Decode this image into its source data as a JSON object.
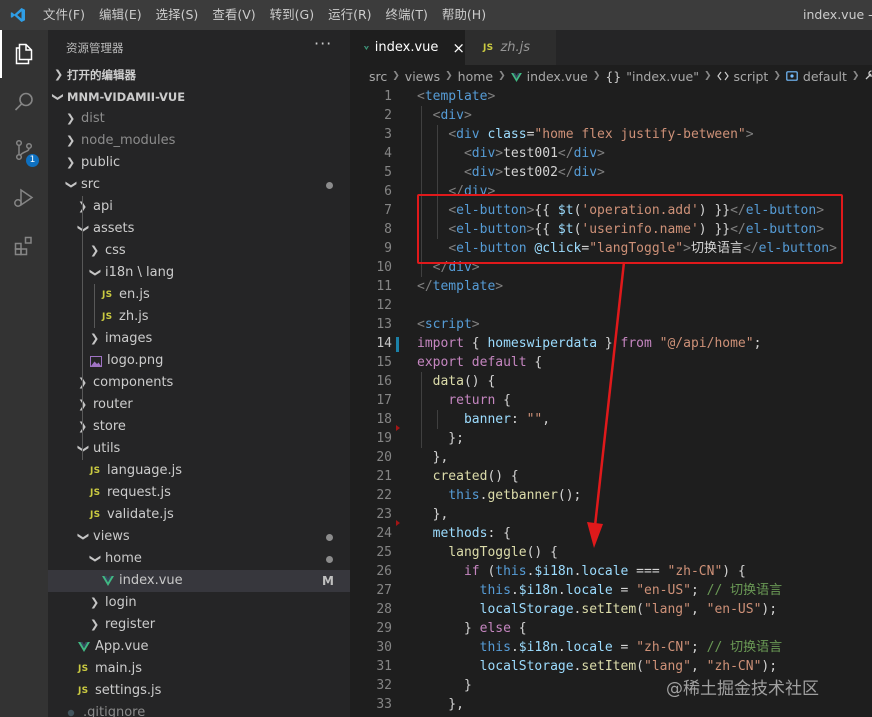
{
  "titlebar": {
    "menu": [
      "文件(F)",
      "编辑(E)",
      "选择(S)",
      "查看(V)",
      "转到(G)",
      "运行(R)",
      "终端(T)",
      "帮助(H)"
    ],
    "window_title": "index.vue - m"
  },
  "activity": {
    "items": [
      "explorer-icon",
      "search-icon",
      "source-control-icon",
      "run-debug-icon",
      "extensions-icon"
    ],
    "scm_badge": "1"
  },
  "sidebar": {
    "title": "资源管理器",
    "more": "···",
    "open_editors": "打开的编辑器",
    "project": "MNM-VIDAMII-VUE",
    "tree": [
      {
        "label": "dist",
        "kind": "folder",
        "state": "collapsed",
        "depth": 1
      },
      {
        "label": "node_modules",
        "kind": "folder",
        "state": "collapsed",
        "depth": 1
      },
      {
        "label": "public",
        "kind": "folder",
        "state": "collapsed",
        "depth": 1
      },
      {
        "label": "src",
        "kind": "folder",
        "state": "expanded",
        "depth": 1,
        "dot": true
      },
      {
        "label": "api",
        "kind": "folder",
        "state": "collapsed",
        "depth": 2
      },
      {
        "label": "assets",
        "kind": "folder",
        "state": "expanded",
        "depth": 2
      },
      {
        "label": "css",
        "kind": "folder",
        "state": "collapsed",
        "depth": 3
      },
      {
        "label": "i18n \\ lang",
        "kind": "folder",
        "state": "expanded",
        "depth": 3
      },
      {
        "label": "en.js",
        "kind": "js",
        "depth": 4
      },
      {
        "label": "zh.js",
        "kind": "js",
        "depth": 4
      },
      {
        "label": "images",
        "kind": "folder",
        "state": "collapsed",
        "depth": 3
      },
      {
        "label": "logo.png",
        "kind": "image",
        "depth": 3
      },
      {
        "label": "components",
        "kind": "folder",
        "state": "collapsed",
        "depth": 2
      },
      {
        "label": "router",
        "kind": "folder",
        "state": "collapsed",
        "depth": 2
      },
      {
        "label": "store",
        "kind": "folder",
        "state": "collapsed",
        "depth": 2
      },
      {
        "label": "utils",
        "kind": "folder",
        "state": "expanded",
        "depth": 2
      },
      {
        "label": "language.js",
        "kind": "js",
        "depth": 3
      },
      {
        "label": "request.js",
        "kind": "js",
        "depth": 3
      },
      {
        "label": "validate.js",
        "kind": "js",
        "depth": 3
      },
      {
        "label": "views",
        "kind": "folder",
        "state": "expanded",
        "depth": 2,
        "dot": true,
        "git": "modified"
      },
      {
        "label": "home",
        "kind": "folder",
        "state": "expanded",
        "depth": 3,
        "dot": true,
        "git": "modified"
      },
      {
        "label": "index.vue",
        "kind": "vue",
        "depth": 4,
        "flag": "M",
        "selected": true,
        "git": "modified"
      },
      {
        "label": "login",
        "kind": "folder",
        "state": "collapsed",
        "depth": 3
      },
      {
        "label": "register",
        "kind": "folder",
        "state": "collapsed",
        "depth": 3
      },
      {
        "label": "App.vue",
        "kind": "vue",
        "depth": 2
      },
      {
        "label": "main.js",
        "kind": "js",
        "depth": 2
      },
      {
        "label": "settings.js",
        "kind": "js",
        "depth": 2
      },
      {
        "label": ".gitignore",
        "kind": "file",
        "depth": 1
      }
    ]
  },
  "editor": {
    "tabs": [
      {
        "label": "index.vue",
        "kind": "vue",
        "active": true,
        "close": "×"
      },
      {
        "label": "zh.js",
        "kind": "js",
        "active": false
      }
    ],
    "breadcrumb": [
      "src",
      "views",
      "home",
      "index.vue",
      "\"index.vue\"",
      "script",
      "default",
      "me"
    ],
    "current_line": 14,
    "code": [
      {
        "n": 1,
        "tokens": [
          [
            "br",
            "<"
          ],
          [
            "tag",
            "template"
          ],
          [
            "br",
            ">"
          ]
        ]
      },
      {
        "n": 2,
        "tokens": [
          [
            "txt",
            "  "
          ],
          [
            "br",
            "<"
          ],
          [
            "tag",
            "div"
          ],
          [
            "br",
            ">"
          ]
        ]
      },
      {
        "n": 3,
        "tokens": [
          [
            "txt",
            "    "
          ],
          [
            "br",
            "<"
          ],
          [
            "tag",
            "div"
          ],
          [
            "txt",
            " "
          ],
          [
            "attr",
            "class"
          ],
          [
            "txt",
            "="
          ],
          [
            "str",
            "\"home flex justify-between\""
          ],
          [
            "br",
            ">"
          ]
        ]
      },
      {
        "n": 4,
        "tokens": [
          [
            "txt",
            "      "
          ],
          [
            "br",
            "<"
          ],
          [
            "tag",
            "div"
          ],
          [
            "br",
            ">"
          ],
          [
            "txt",
            "test001"
          ],
          [
            "br",
            "</"
          ],
          [
            "tag",
            "div"
          ],
          [
            "br",
            ">"
          ]
        ]
      },
      {
        "n": 5,
        "tokens": [
          [
            "txt",
            "      "
          ],
          [
            "br",
            "<"
          ],
          [
            "tag",
            "div"
          ],
          [
            "br",
            ">"
          ],
          [
            "txt",
            "test002"
          ],
          [
            "br",
            "</"
          ],
          [
            "tag",
            "div"
          ],
          [
            "br",
            ">"
          ]
        ]
      },
      {
        "n": 6,
        "tokens": [
          [
            "txt",
            "    "
          ],
          [
            "br",
            "</"
          ],
          [
            "tag",
            "div"
          ],
          [
            "br",
            ">"
          ]
        ]
      },
      {
        "n": 7,
        "tokens": [
          [
            "txt",
            "    "
          ],
          [
            "br",
            "<"
          ],
          [
            "tag",
            "el-button"
          ],
          [
            "br",
            ">"
          ],
          [
            "txt",
            "{{ "
          ],
          [
            "var",
            "$t"
          ],
          [
            "txt",
            "("
          ],
          [
            "str",
            "'operation.add'"
          ],
          [
            "txt",
            ") }}"
          ],
          [
            "br",
            "</"
          ],
          [
            "tag",
            "el-button"
          ],
          [
            "br",
            ">"
          ]
        ]
      },
      {
        "n": 8,
        "tokens": [
          [
            "txt",
            "    "
          ],
          [
            "br",
            "<"
          ],
          [
            "tag",
            "el-button"
          ],
          [
            "br",
            ">"
          ],
          [
            "txt",
            "{{ "
          ],
          [
            "var",
            "$t"
          ],
          [
            "txt",
            "("
          ],
          [
            "str",
            "'userinfo.name'"
          ],
          [
            "txt",
            ") }}"
          ],
          [
            "br",
            "</"
          ],
          [
            "tag",
            "el-button"
          ],
          [
            "br",
            ">"
          ]
        ]
      },
      {
        "n": 9,
        "tokens": [
          [
            "txt",
            "    "
          ],
          [
            "br",
            "<"
          ],
          [
            "tag",
            "el-button"
          ],
          [
            "txt",
            " "
          ],
          [
            "attr",
            "@click"
          ],
          [
            "txt",
            "="
          ],
          [
            "str",
            "\"langToggle\""
          ],
          [
            "br",
            ">"
          ],
          [
            "txt",
            "切换语言"
          ],
          [
            "br",
            "</"
          ],
          [
            "tag",
            "el-button"
          ],
          [
            "br",
            ">"
          ]
        ]
      },
      {
        "n": 10,
        "tokens": [
          [
            "txt",
            "  "
          ],
          [
            "br",
            "</"
          ],
          [
            "tag",
            "div"
          ],
          [
            "br",
            ">"
          ]
        ]
      },
      {
        "n": 11,
        "tokens": [
          [
            "br",
            "</"
          ],
          [
            "tag",
            "template"
          ],
          [
            "br",
            ">"
          ]
        ]
      },
      {
        "n": 12,
        "tokens": []
      },
      {
        "n": 13,
        "tokens": [
          [
            "br",
            "<"
          ],
          [
            "tag",
            "script"
          ],
          [
            "br",
            ">"
          ]
        ]
      },
      {
        "n": 14,
        "tokens": [
          [
            "kw",
            "import"
          ],
          [
            "txt",
            " { "
          ],
          [
            "var",
            "homeswiperdata"
          ],
          [
            "txt",
            " } "
          ],
          [
            "kw",
            "from"
          ],
          [
            "txt",
            " "
          ],
          [
            "str",
            "\"@/api/home\""
          ],
          [
            "txt",
            ";"
          ]
        ]
      },
      {
        "n": 15,
        "tokens": [
          [
            "kw",
            "export"
          ],
          [
            "txt",
            " "
          ],
          [
            "kw",
            "default"
          ],
          [
            "txt",
            " {"
          ]
        ]
      },
      {
        "n": 16,
        "tokens": [
          [
            "txt",
            "  "
          ],
          [
            "fn",
            "data"
          ],
          [
            "txt",
            "() {"
          ]
        ]
      },
      {
        "n": 17,
        "tokens": [
          [
            "txt",
            "    "
          ],
          [
            "kw",
            "return"
          ],
          [
            "txt",
            " {"
          ]
        ]
      },
      {
        "n": 18,
        "tokens": [
          [
            "txt",
            "      "
          ],
          [
            "var",
            "banner"
          ],
          [
            "txt",
            ": "
          ],
          [
            "str",
            "\"\""
          ],
          [
            "txt",
            ","
          ]
        ]
      },
      {
        "n": 19,
        "tokens": [
          [
            "txt",
            "    };"
          ]
        ]
      },
      {
        "n": 20,
        "tokens": [
          [
            "txt",
            "  },"
          ]
        ]
      },
      {
        "n": 21,
        "tokens": [
          [
            "txt",
            "  "
          ],
          [
            "fn",
            "created"
          ],
          [
            "txt",
            "() {"
          ]
        ]
      },
      {
        "n": 22,
        "tokens": [
          [
            "txt",
            "    "
          ],
          [
            "kw2",
            "this"
          ],
          [
            "txt",
            "."
          ],
          [
            "fn",
            "getbanner"
          ],
          [
            "txt",
            "();"
          ]
        ]
      },
      {
        "n": 23,
        "tokens": [
          [
            "txt",
            "  },"
          ]
        ]
      },
      {
        "n": 24,
        "tokens": [
          [
            "txt",
            "  "
          ],
          [
            "var",
            "methods"
          ],
          [
            "txt",
            ": {"
          ]
        ]
      },
      {
        "n": 25,
        "tokens": [
          [
            "txt",
            "    "
          ],
          [
            "fn",
            "langToggle"
          ],
          [
            "txt",
            "() {"
          ]
        ]
      },
      {
        "n": 26,
        "tokens": [
          [
            "txt",
            "      "
          ],
          [
            "kw",
            "if"
          ],
          [
            "txt",
            " ("
          ],
          [
            "kw2",
            "this"
          ],
          [
            "txt",
            "."
          ],
          [
            "var",
            "$i18n"
          ],
          [
            "txt",
            "."
          ],
          [
            "var",
            "locale"
          ],
          [
            "txt",
            " === "
          ],
          [
            "str",
            "\"zh-CN\""
          ],
          [
            "txt",
            ") {"
          ]
        ]
      },
      {
        "n": 27,
        "tokens": [
          [
            "txt",
            "        "
          ],
          [
            "kw2",
            "this"
          ],
          [
            "txt",
            "."
          ],
          [
            "var",
            "$i18n"
          ],
          [
            "txt",
            "."
          ],
          [
            "var",
            "locale"
          ],
          [
            "txt",
            " = "
          ],
          [
            "str",
            "\"en-US\""
          ],
          [
            "txt",
            "; "
          ],
          [
            "cm",
            "// 切换语言"
          ]
        ]
      },
      {
        "n": 28,
        "tokens": [
          [
            "txt",
            "        "
          ],
          [
            "var",
            "localStorage"
          ],
          [
            "txt",
            "."
          ],
          [
            "fn",
            "setItem"
          ],
          [
            "txt",
            "("
          ],
          [
            "str",
            "\"lang\""
          ],
          [
            "txt",
            ", "
          ],
          [
            "str",
            "\"en-US\""
          ],
          [
            "txt",
            ");"
          ]
        ]
      },
      {
        "n": 29,
        "tokens": [
          [
            "txt",
            "      } "
          ],
          [
            "kw",
            "else"
          ],
          [
            "txt",
            " {"
          ]
        ]
      },
      {
        "n": 30,
        "tokens": [
          [
            "txt",
            "        "
          ],
          [
            "kw2",
            "this"
          ],
          [
            "txt",
            "."
          ],
          [
            "var",
            "$i18n"
          ],
          [
            "txt",
            "."
          ],
          [
            "var",
            "locale"
          ],
          [
            "txt",
            " = "
          ],
          [
            "str",
            "\"zh-CN\""
          ],
          [
            "txt",
            "; "
          ],
          [
            "cm",
            "// 切换语言"
          ]
        ]
      },
      {
        "n": 31,
        "tokens": [
          [
            "txt",
            "        "
          ],
          [
            "var",
            "localStorage"
          ],
          [
            "txt",
            "."
          ],
          [
            "fn",
            "setItem"
          ],
          [
            "txt",
            "("
          ],
          [
            "str",
            "\"lang\""
          ],
          [
            "txt",
            ", "
          ],
          [
            "str",
            "\"zh-CN\""
          ],
          [
            "txt",
            ");"
          ]
        ]
      },
      {
        "n": 32,
        "tokens": [
          [
            "txt",
            "      }"
          ]
        ]
      },
      {
        "n": 33,
        "tokens": [
          [
            "txt",
            "    },"
          ]
        ]
      }
    ]
  },
  "watermark": "@稀土掘金技术社区",
  "colors": {
    "highlight_box": "#e0191b",
    "git_modified": "#1b81a8",
    "badge": "#0e70c0"
  }
}
